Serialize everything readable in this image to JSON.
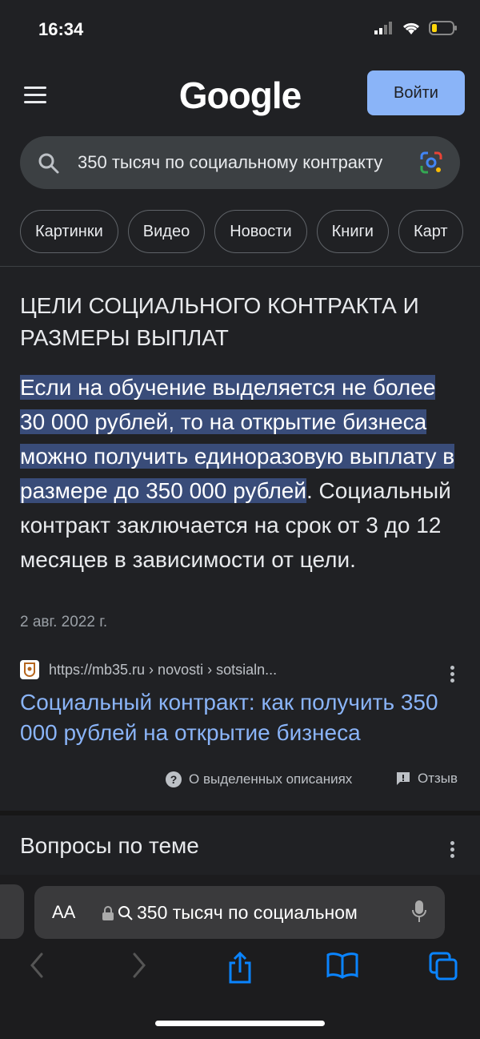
{
  "status": {
    "time": "16:34"
  },
  "header": {
    "logo": "Google",
    "login_label": "Войти"
  },
  "search": {
    "query": "350 тысяч по социальному контракту"
  },
  "chips": [
    "Картинки",
    "Видео",
    "Новости",
    "Книги",
    "Карт"
  ],
  "featured": {
    "heading": "ЦЕЛИ СОЦИАЛЬНОГО КОНТРАКТА И РАЗМЕРЫ ВЫПЛАТ",
    "highlight": "Если на обучение выделяется не более 30 000 рублей, то на открытие бизнеса можно получить единоразовую выплату в размере до 350 000 рублей",
    "rest": ". Социальный контракт заключается на срок от 3 до 12 месяцев в зависимости от цели.",
    "date": "2 авг. 2022 г."
  },
  "result": {
    "url": "https://mb35.ru › novosti › sotsialn...",
    "title": "Социальный контракт: как получить 350 000 рублей на открытие бизнеса"
  },
  "about": {
    "label": "О выделенных описаниях",
    "feedback": "Отзыв"
  },
  "questions": {
    "title": "Вопросы по теме"
  },
  "safari": {
    "aa": "АA",
    "address": "350 тысяч по социальном"
  },
  "colors": {
    "accent": "#8ab4f8",
    "highlight": "#394c79",
    "background": "#202124"
  }
}
